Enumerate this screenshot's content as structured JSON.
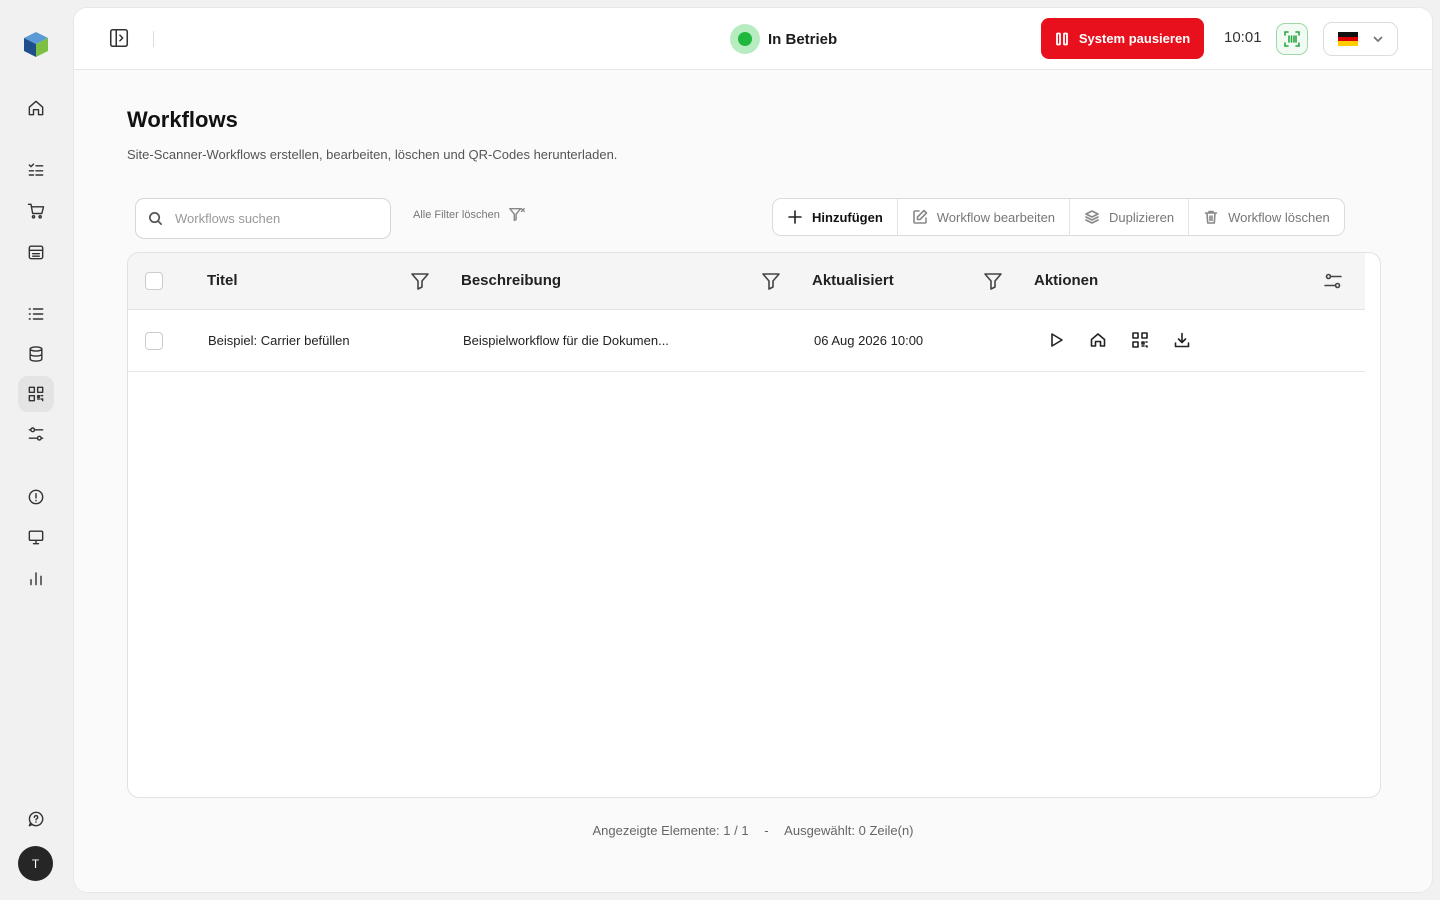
{
  "topbar": {
    "status_text": "In Betrieb",
    "pause_label": "System pausieren",
    "clock": "10:01",
    "language_flag": "de"
  },
  "colors": {
    "accent_red": "#e8101d",
    "status_green": "#1fb83c",
    "scan_green": "#2aa544"
  },
  "sidebar": {
    "items": [
      {
        "name": "home-icon"
      },
      {
        "name": "checklist-icon"
      },
      {
        "name": "cart-icon"
      },
      {
        "name": "archive-icon"
      },
      {
        "name": "list-icon"
      },
      {
        "name": "database-icon"
      },
      {
        "name": "qr-code-icon",
        "active": true
      },
      {
        "name": "sliders-icon"
      },
      {
        "name": "alert-circle-icon"
      },
      {
        "name": "monitor-icon"
      },
      {
        "name": "bar-chart-icon"
      },
      {
        "name": "help-icon"
      }
    ],
    "avatar_initial": "T"
  },
  "page": {
    "title": "Workflows",
    "subtitle": "Site-Scanner-Workflows erstellen, bearbeiten, löschen und QR-Codes herunterladen."
  },
  "toolbar": {
    "search_placeholder": "Workflows suchen",
    "clear_filters": "Alle Filter löschen",
    "add": "Hinzufügen",
    "edit": "Workflow bearbeiten",
    "duplicate": "Duplizieren",
    "delete": "Workflow löschen"
  },
  "table": {
    "columns": [
      "Titel",
      "Beschreibung",
      "Aktualisiert",
      "Aktionen"
    ],
    "rows": [
      {
        "title": "Beispiel: Carrier befüllen",
        "description": "Beispielworkflow für die Dokumen...",
        "updated": "06 Aug 2026 10:00"
      }
    ]
  },
  "footer": {
    "shown": "Angezeigte Elemente: 1 / 1",
    "separator": "-",
    "selected": "Ausgewählt: 0 Zeile(n)"
  }
}
